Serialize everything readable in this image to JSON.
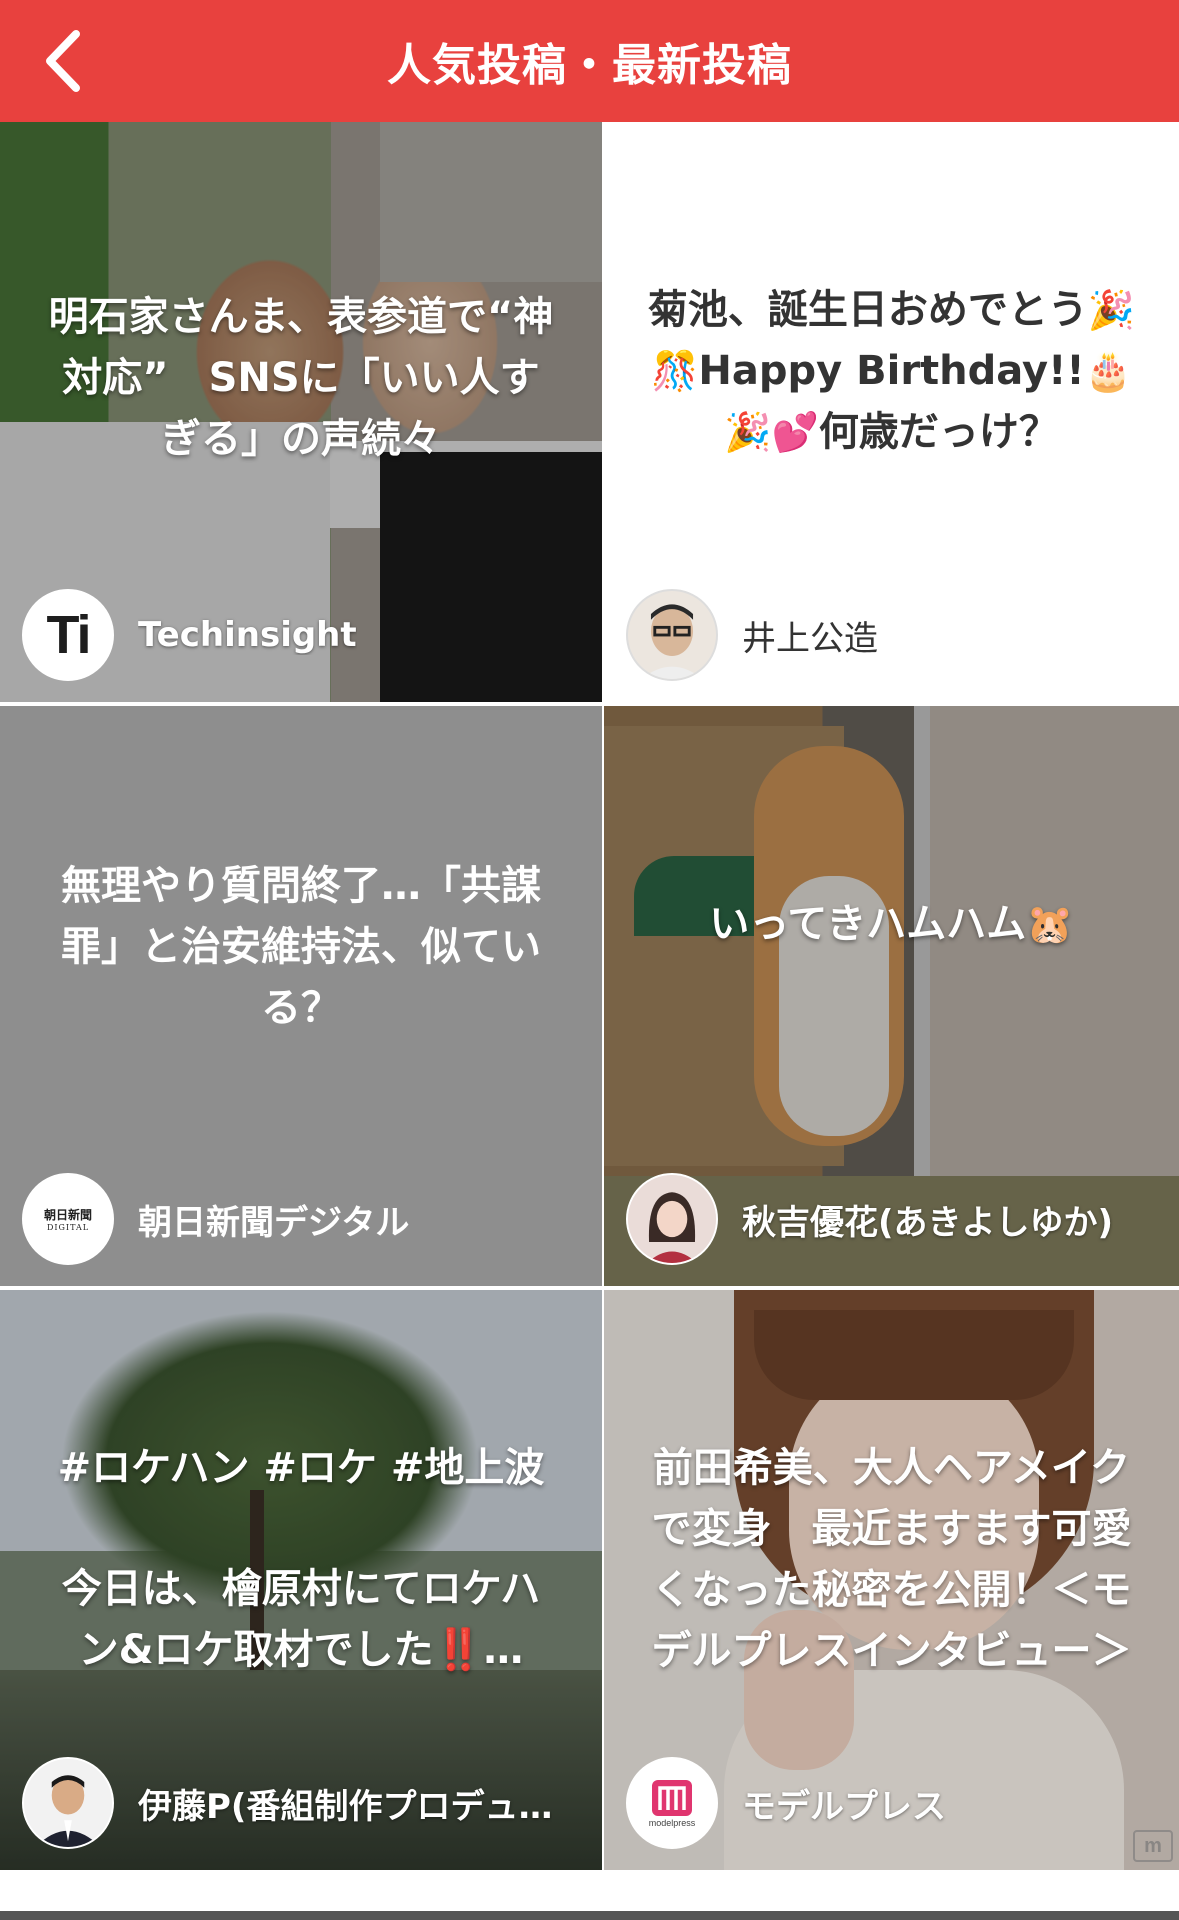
{
  "header": {
    "title": "人気投稿・最新投稿",
    "back_icon": "chevron-left-icon",
    "background": "#e8413e"
  },
  "posts": [
    {
      "text_lines": [
        "明石家さんま、表参道で“神",
        "対応”　SNSに「いい人す",
        "ぎる」の声続々"
      ],
      "author": "Techinsight",
      "avatar_text": "Ti"
    },
    {
      "text_line_1": "菊池、誕生日おめでとう",
      "text_line_2": "Happy Birthday!!",
      "text_line_3": "何歳だっけ？",
      "emoji_party": "🎉",
      "emoji_confetti": "🎊",
      "emoji_cake": "🎂",
      "emoji_hearts": "💕",
      "author": "井上公造"
    },
    {
      "text_lines": [
        "無理やり質問終了…「共謀",
        "罪」と治安維持法、似てい",
        "る？"
      ],
      "author": "朝日新聞デジタル",
      "avatar_text_1": "朝日新聞",
      "avatar_text_2": "DIGITAL"
    },
    {
      "text": "いってきハムハム",
      "emoji_hamster": "🐹",
      "author": "秋吉優花(あきよしゆか)"
    },
    {
      "hashtags": "#ロケハン #ロケ #地上波",
      "text_lines": [
        "今日は、檜原村にてロケハ",
        "ン&ロケ取材でした"
      ],
      "emoji_bang": "‼️",
      "ellipsis": "…",
      "author": "伊藤P(番組制作プロデュ…"
    },
    {
      "text_lines": [
        "前田希美、大人ヘアメイク",
        "で変身　最近ますます可愛",
        "くなった秘密を公開！＜モ",
        "デルプレスインタビュー＞"
      ],
      "author": "モデルプレス",
      "avatar_text": "modelpress",
      "corner_mark": "m"
    }
  ]
}
